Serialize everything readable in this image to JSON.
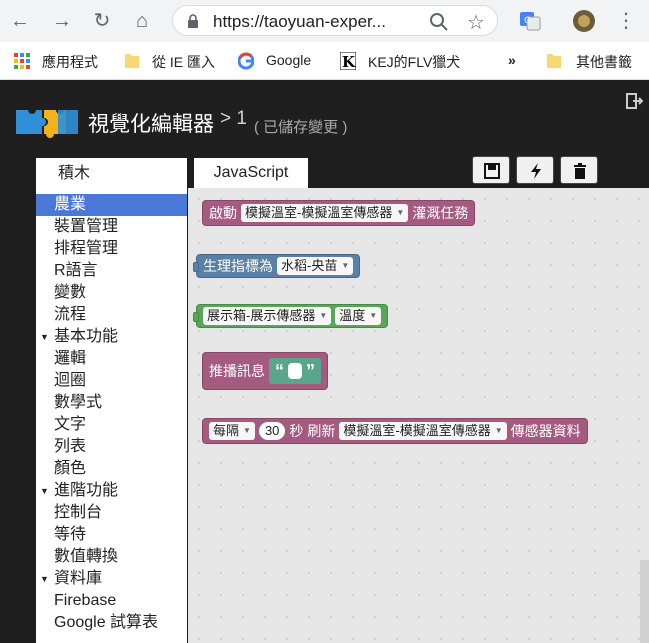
{
  "browser": {
    "url": "https://taoyuan-exper...",
    "bookmarks": [
      {
        "label": "應用程式"
      },
      {
        "label": "從 IE 匯入"
      },
      {
        "label": "Google"
      },
      {
        "label": "KEJ的FLV獵犬"
      },
      {
        "label": "»"
      },
      {
        "label": "其他書籤"
      }
    ]
  },
  "app": {
    "title": "視覺化編輯器",
    "crumb": "> 1",
    "saved_status": "( 已儲存變更 )"
  },
  "toolbox": {
    "header": "積木",
    "items": [
      {
        "label": "農業",
        "selected": true
      },
      {
        "label": "裝置管理"
      },
      {
        "label": "排程管理"
      },
      {
        "label": "R語言"
      },
      {
        "label": "變數"
      },
      {
        "label": "流程"
      },
      {
        "label": "基本功能",
        "expanded": true
      },
      {
        "label": "邏輯"
      },
      {
        "label": "迴圈"
      },
      {
        "label": "數學式"
      },
      {
        "label": "文字"
      },
      {
        "label": "列表"
      },
      {
        "label": "顏色"
      },
      {
        "label": "進階功能",
        "expanded": true
      },
      {
        "label": "控制台"
      },
      {
        "label": "等待"
      },
      {
        "label": "數值轉換"
      },
      {
        "label": "資料庫",
        "expanded": true
      },
      {
        "label": "Firebase"
      },
      {
        "label": "Google 試算表"
      }
    ]
  },
  "editor": {
    "tab_label": "JavaScript",
    "tools": [
      "save-icon",
      "flash-icon",
      "trash-icon"
    ]
  },
  "blocks": {
    "b1": {
      "label1": "啟動",
      "dropdown": "模擬溫室-模擬溫室傳感器",
      "label2": "灌溉任務"
    },
    "b2": {
      "label": "生理指標為",
      "dropdown": "水稻-央苗"
    },
    "b3": {
      "dropdown1": "展示箱-展示傳感器",
      "dropdown2": "溫度"
    },
    "b4": {
      "label": "推播訊息",
      "quote_open": "“",
      "quote_close": "”"
    },
    "b5": {
      "dropdown1": "每隔",
      "number": "30",
      "label1": "秒",
      "label2": "刷新",
      "dropdown2": "模擬溫室-模擬溫室傳感器",
      "label3": "傳感器資料"
    }
  },
  "colors": {
    "accent": "#4a78d8",
    "block_pink": "#a55b80",
    "block_blue": "#5b80a5",
    "block_green": "#5ba55b"
  }
}
